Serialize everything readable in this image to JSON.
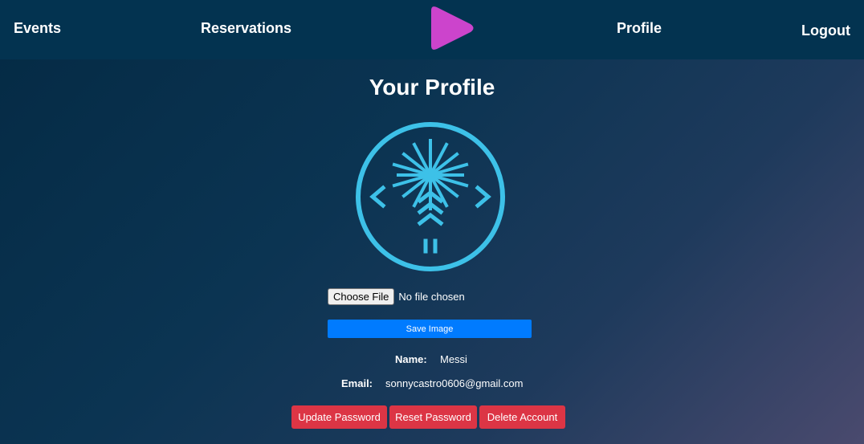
{
  "nav": {
    "events": "Events",
    "reservations": "Reservations",
    "profile": "Profile",
    "logout": "Logout"
  },
  "colors": {
    "navbar": "#033350",
    "logo": "#cc44cc",
    "avatar_stroke": "#3dc1e8",
    "primary_button": "#007bff",
    "danger_button": "#dc3545"
  },
  "icons": {
    "logo": "play-logo-icon",
    "avatar": "palm-tree-code-icon"
  },
  "profile": {
    "title": "Your Profile",
    "file_button": "Choose File",
    "file_status": "No file chosen",
    "save_image": "Save Image",
    "name_label": "Name:",
    "name_value": "Messi",
    "email_label": "Email:",
    "email_value": "sonnycastro0606@gmail.com"
  },
  "actions": {
    "update_password": "Update Password",
    "reset_password": "Reset Password",
    "delete_account": "Delete Account"
  }
}
